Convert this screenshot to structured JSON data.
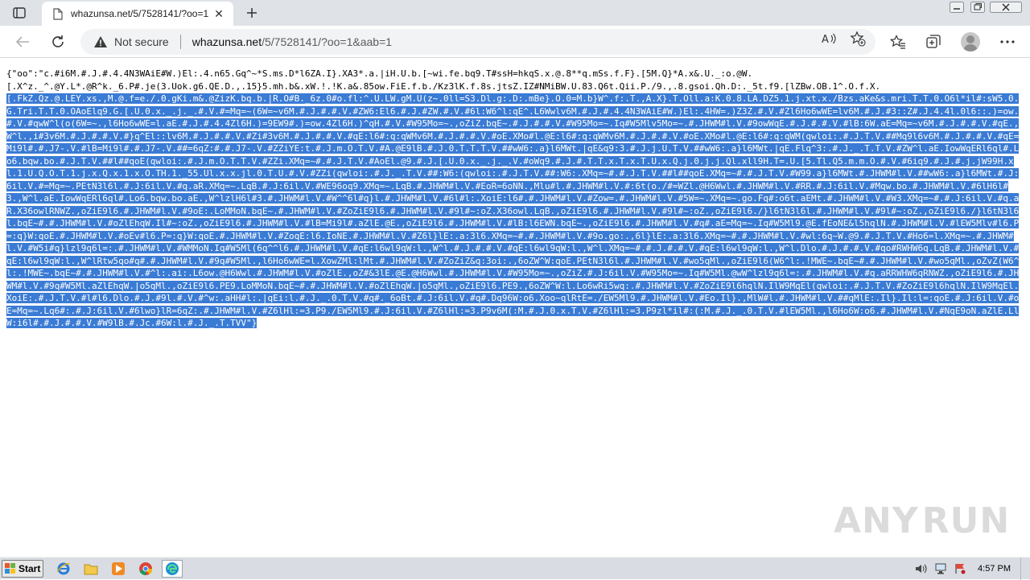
{
  "browser": {
    "tab": {
      "title": "whazunsa.net/5/7528141/?oo=1"
    },
    "address": {
      "security_label": "Not secure",
      "url_host": "whazunsa.net",
      "url_path": "/5/7528141/?oo=1&aab=1"
    }
  },
  "page": {
    "text_unselected": "{\"oo\":\"c.#i6M.#.J.#.4.4N3WAiE#W.)El:.4.n65.Gq^~*S.ms.D*l6ZA.I}.XA3*.a.|iH.U.b.[~wi.fe.bq9.T#ssH=hkqS.x.@.8**q.mSs.f.F}.[5M.Q}*A.x&.U._:o.@W.\n[.X^z._^.@Y.L*.@R^k._6.P#.je(3.Uok.g6.QE.D.,.15}5.mh.b&.xW.!.!K.a&.85ow.FiE.f.b./Kz3lK.f.8s.jtsZ.IZ#NMiBW.U.83.Q6t.Qii.P./9.,.8.gsoi.Qh.D:._5t.f9.[lZBw.OB.1^.O.f.X.\n",
    "text_selected": "[.FkZ.Qz.@.LEY.xs.,M.@.f=e./.0.gKi.m&.@ZizK.bq.b.|R.O#B._6z.0#o.fl:^.U.LW.gM.U(z~.0ll=S3.Dl.g:.D:.mBe}.O.0=M.b}W^.f:.T.,A.X}.T.Oll.a:K.0.8.LA.DZ5.1.j.xt.x./Bzs.aKe&s.mri.T.T.0.O6l*il#:sW5.0.G.Tri.T.T.0.OAoElq9.G.[.U.0.x._.j._.#.V.#=Mq=~(6W=~v6M.#.J.#.#.V.#ZW6:El6.#.J.#ZW.#.V.#6l:W6^l:qE^.L6Wwlv6M.#.J.#.4.4N3WAiE#W.)El:.4HW=.)Z3Z.#.V.#Zl6Ho6wWE=lv6M.#.J.#3::Z#.J.4.4l.0l6::.)=ow.#.V.#qwW^l(o(6W=~.,l6Ho6wWE=l.aE.#.J.#.4.4Zl6H.)=9EW9#.)=ow.4Zl6H.)^qH.#.V.#W95Mo=~.,oZiZ.bqE~.#.J.#.#.V.#W95Mo=~.Iq#W5Mlv5Mo=~.#.JHWM#l.V.#9owWqE.#.J.#.#.V.#lB:6W.aE=Mq=~v6M.#.J.#.#.V.#qE.,W^l.,i#3v6M.#.J.#.#.V.#}q^El::lv6M.#.J.#.#.V.#Zi#3v6M.#.J.#.#.V.#qE:l6#:q:qWMv6M.#.J.#.#.V.#oE.XMo#l.@E:l6#:q:qWMv6M.#.J.#.#.V.#oE.XMo#l.@E:l6#:q:qWM(qwloi:.#.J.T.V.##Mq9l6v6M.#.J.#.#.V.#qE=Mi9l#.#.J7-.V.#lB=Mi9l#.#.J7-.V.##=6qZ:#.#.J7-.V.#ZZiYE:t.#.J.m.O.T.V.#A.@E9lB.#.J.0.T.T.T.V.##wW6:.a}l6MWt.|qE&q9:3.#.J.j.U.T.V.##wW6:.a}l6MWt.|qE.Flq^3:.#.J._.T.T.V.#ZW^l.aE.IowWqERl6ql#.Lo6.bqw.bo.#.J.T.V.##l##qoE(qwloi:.#.J.m.O.T.T.V.#ZZi.XMq=~#.#.J.T.V.#AoEl.@9.#.J.[.U.0.x._.j._.V.#oWq9.#.J.#.T.T.x.T.x.T.U.x.Q.j.0.j.j.Ql.xll9H.T=.U.[5.Tl.Q5.m.m.O.#.V.#6iq9.#.J.#.j.jW99H.xl.1.U.Q.O.T.1.j.x.Q.x.1.x.O.TH.1._55.Ul.x.x.jl.0.T.U.#.V.#ZZi(qwloi:.#.J._.T.V.##:W6:(qwloi:.#.J.T.V.##:W6:.XMq=~#.#.J.T.V.##l##qoE.XMq=~#.#.J.T.V.#W99.a}l6MWt.#.JHWM#l.V.##wW6:.a}l6MWt.#.J:6il.V.#=Mq=~.PEtN3l6l.#.J:6il.V.#q.aR.XMq=~.LqB.#.J:6il.V.#WE96oq9.XMq=~.LqB.#.JHWM#l.V.#EoR=6oNN.,Mlu#l.#.JHWM#l.V.#:6t(o./#=WZl.@H6Wwl.#.JHWM#l.V.#RR.#.J:6il.V.#Mqw.bo.#.JHWM#l.V.#6lH6l#3.,W^l.aE.IowWqERl6ql#.Lo6.bqw.bo.aE.,W^lzlH6l#3.#.JHWM#l.V.#W^^6l#q}l.#.JHWM#l.V.#6l#l:.XoiE:l6#.#.JHWM#l.V.#Zow=.#.JHWM#l.V.#5W=~.XMq=~.go.Fq#:o6t.aEMt.#.JHWM#l.V.#W3.XMq=~#.#.J:6il.V.#q.aR.X36owlRNWZ.,oZiE9l6.#.JHWM#l.V.#9oE:.LoMMoN.bqE~.#.JHWM#l.V.#ZoZiE9l6.#.JHWM#l.V.#9l#~:oZ.X36owl.LqB.,oZiE9l6.#.JHWM#l.V.#9l#~:oZ.,oZiE9l6./}l6tN3l6l.#.JHWM#l.V.#9l#~:oZ.,oZiE9l6./}l6tN3l6l.bqE~#.#.JHWM#l.V.#oZlEhqW.Il#~:oZ.,oZiE9l6.#.JHWM#l.V.#lB=Mi9l#.aZlE.@E.,oZiE9l6.#.JHWM#l.V.#lB:l6EWN.bqE~.,oZiE9l6.#.JHWM#l.V.#q#.aE=Mq=~.Iq#W5Ml9.@E.fEoNE&l5hqlN.#.JHWM#l.V.#lEW5Mlv#l6.P=:q}W:qoE.#.JHWM#l.V.#oEv#l6.P=:q}W:qoE.#.JHWM#l.V.#ZoqE:l6.IoNE.#.JHWM#l.V.#Z6l}lE:.a:3l6.XMq=~#.#.JHWM#l.V.#9o.go:.,6l}lE:.a:3l6.XMq=~#.#.JHWM#l.V.#wl:6q~W.@9.#.J.T.V.#Ho6=l.XMq=~.#.JHWM#l.V.#W5i#q}lzl9q6l=:.#.JHWM#l.V.#WMMoN.Iq#W5Ml(6q^^l6.#.JHWM#l.V.#qE:l6wl9qW:l.,W^l.#.J.#.#.V.#qE:l6wl9qW:l.,W^l.XMq=~#.#.J.#.#.V.#qE:l6wl9qW:l.,W^l.Dlo.#.J.#.#.V.#qo#RWHW6q.LqB.#.JHWM#l.V.#qE:l6wl9qW:l.,W^lRtw5qo#q#.#.JHWM#l.V.#9q#W5Ml.,l6Ho6wWE=l.XowZMl:lMt.#.JHWM#l.V.#ZoZiZ&q:3oi:.,6oZW^W:qoE.PEtN3l6l.#.JHWM#l.V.#wo5qMl.,oZiE9l6(W6^l:.!MWE~.bqE~#.#.JHWM#l.V.#wo5qMl.,oZvZ(W6^l:.!MWE~.bqE~#.#.JHWM#l.V.#^l:.ai:.L6ow.@H6Wwl.#.JHWM#l.V.#oZlE.,oZ#&3lE.@E.@H6Wwl.#.JHWM#l.V.#W95Mo=~.,oZiZ.#.J:6il.V.#W95Mo=~.Iq#W5Ml.@wW^lzl9q6l=:.#.JHWM#l.V.#q.aRRWHW6qRNWZ.,oZiE9l6.#.JHWM#l.V.#9q#W5Ml.aZlEhqW.|o5qMl.,oZiE9l6.PE9.LoMMoN.bqE~#.#.JHWM#l.V.#oZlEhqW.|o5qMl.,oZiE9l6.PE9.,6oZW^W:l.Lo6wRi5wq:.#.JHWM#l.V.#ZoZiE9l6hqlN.IlW9MqEl(qwloi:.#.J.T.V.#ZoZiE9l6hqlN.IlW9MqEl.XoiE:.#.J.T.V.#l#l6.Dlo.#.J.#9l.#.V.#^w:.aHH#l:.|qEi:l.#.J._.0.T.V.#q#._6oBt.#.J:6il.V.#q#.Dq96W:o6.Xoo~qlRtE=./EW5Ml9.#.JHWM#l.V.#Eo.Il}.,MlW#l.#.JHWM#l.V.##qMlE:.Il}.Il:l=:qoE.#.J:6il.V.#oE=Mq=~.Lq6#:.#.J:6il.V.#6lwo}lR=6qZ:.#.JHWM#l.V.#Z6lHl:=3.P9./EW5Ml9.#.J:6il.V.#Z6lHl:=3.P9v6M(:M.#.J.0.x.T.V.#Z6lHl:=3.P9zl*il#:(:M.#.J._.0.T.V.#lEW5Ml.,l6Ho6W:o6.#.JHWM#l.V.#NqE9oN.aZlE.LlW:i6l#.#.J.#.#.V.#W9lB.#.Jc.#6W:l.#.J._.T.TVV\"}"
  },
  "taskbar": {
    "start_label": "Start",
    "clock": "4:57 PM"
  },
  "watermark": {
    "left": "ANY",
    "right": "RUN"
  },
  "colors": {
    "selection": "#3a7bd5",
    "titlebar": "#dfe3e8",
    "taskbar": "#d9dde3"
  }
}
